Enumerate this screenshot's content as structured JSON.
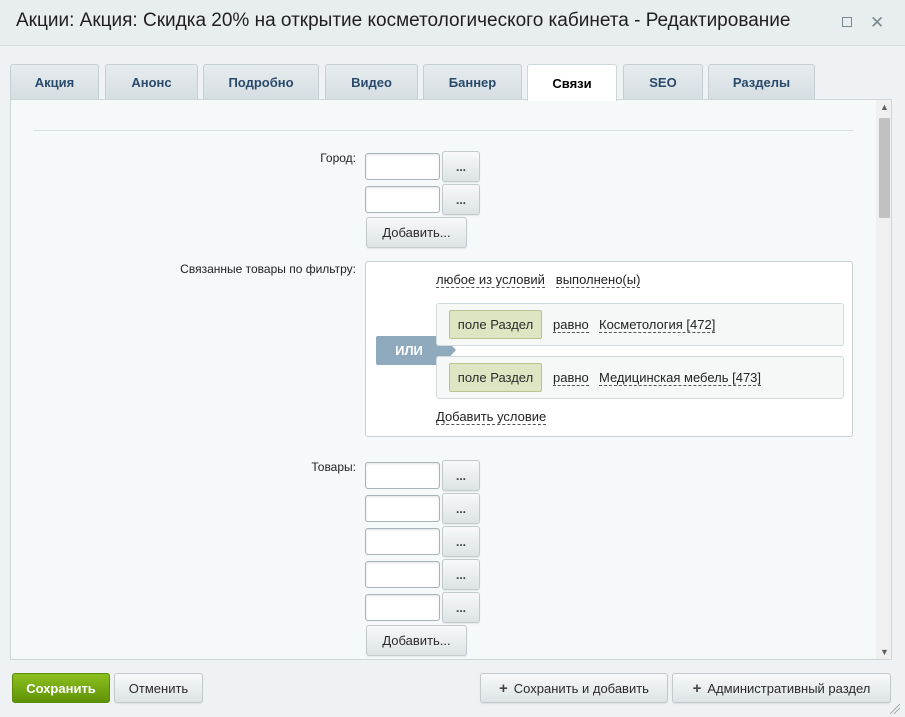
{
  "window": {
    "title": "Акции: Акция: Скидка 20% на открытие косметологического кабинета - Редактирование"
  },
  "tabs": [
    {
      "label": "Акция"
    },
    {
      "label": "Анонс"
    },
    {
      "label": "Подробно"
    },
    {
      "label": "Видео"
    },
    {
      "label": "Баннер"
    },
    {
      "label": "Связи",
      "active": true
    },
    {
      "label": "SEO"
    },
    {
      "label": "Разделы"
    }
  ],
  "form": {
    "city": {
      "label": "Город:",
      "browse_label": "...",
      "add_label": "Добавить..."
    },
    "filter": {
      "label": "Связанные товары по фильтру:",
      "mode_any": "любое из условий",
      "mode_done": "выполнено(ы)",
      "logic": "ИЛИ",
      "conditions": [
        {
          "field": "поле Раздел",
          "op": "равно",
          "value": "Косметология [472]"
        },
        {
          "field": "поле Раздел",
          "op": "равно",
          "value": "Медицинская мебель [473]"
        }
      ],
      "add_condition": "Добавить условие"
    },
    "goods": {
      "label": "Товары:",
      "browse_label": "...",
      "add_label": "Добавить..."
    }
  },
  "footer": {
    "save": "Сохранить",
    "cancel": "Отменить",
    "save_and_add": "Сохранить и добавить",
    "admin_section": "Административный раздел"
  },
  "colors": {
    "save_button": "#6ea812",
    "or_badge": "#8fa9bd",
    "field_chip": "#dde6c2"
  }
}
